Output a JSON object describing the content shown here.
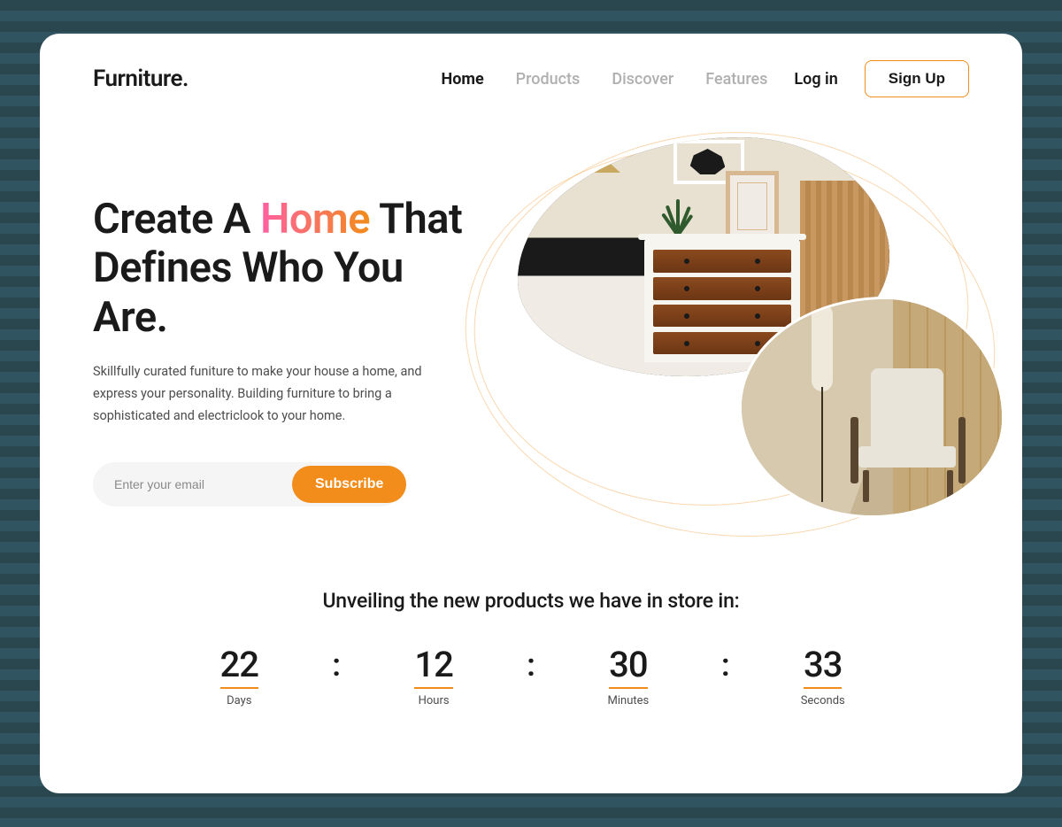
{
  "brand": "Furniture.",
  "nav": {
    "items": [
      {
        "label": "Home",
        "active": true
      },
      {
        "label": "Products",
        "active": false
      },
      {
        "label": "Discover",
        "active": false
      },
      {
        "label": "Features",
        "active": false
      }
    ],
    "login": "Log in",
    "signup": "Sign Up"
  },
  "hero": {
    "title_part1": "Create A ",
    "title_highlight": "Home",
    "title_part2": " That Defines Who You Are.",
    "description": "Skillfully curated funiture to make your house a home, and express your personality. Building furniture to bring a sophisticated and electriclook to your home.",
    "email_placeholder": "Enter your email",
    "subscribe_label": "Subscribe"
  },
  "countdown": {
    "title": "Unveiling the new products we have in store in:",
    "sep": ":",
    "items": [
      {
        "value": "22",
        "label": "Days"
      },
      {
        "value": "12",
        "label": "Hours"
      },
      {
        "value": "30",
        "label": "Minutes"
      },
      {
        "value": "33",
        "label": "Seconds"
      }
    ]
  },
  "colors": {
    "accent": "#f28c1a",
    "highlight_pink": "#ff5fa2"
  }
}
